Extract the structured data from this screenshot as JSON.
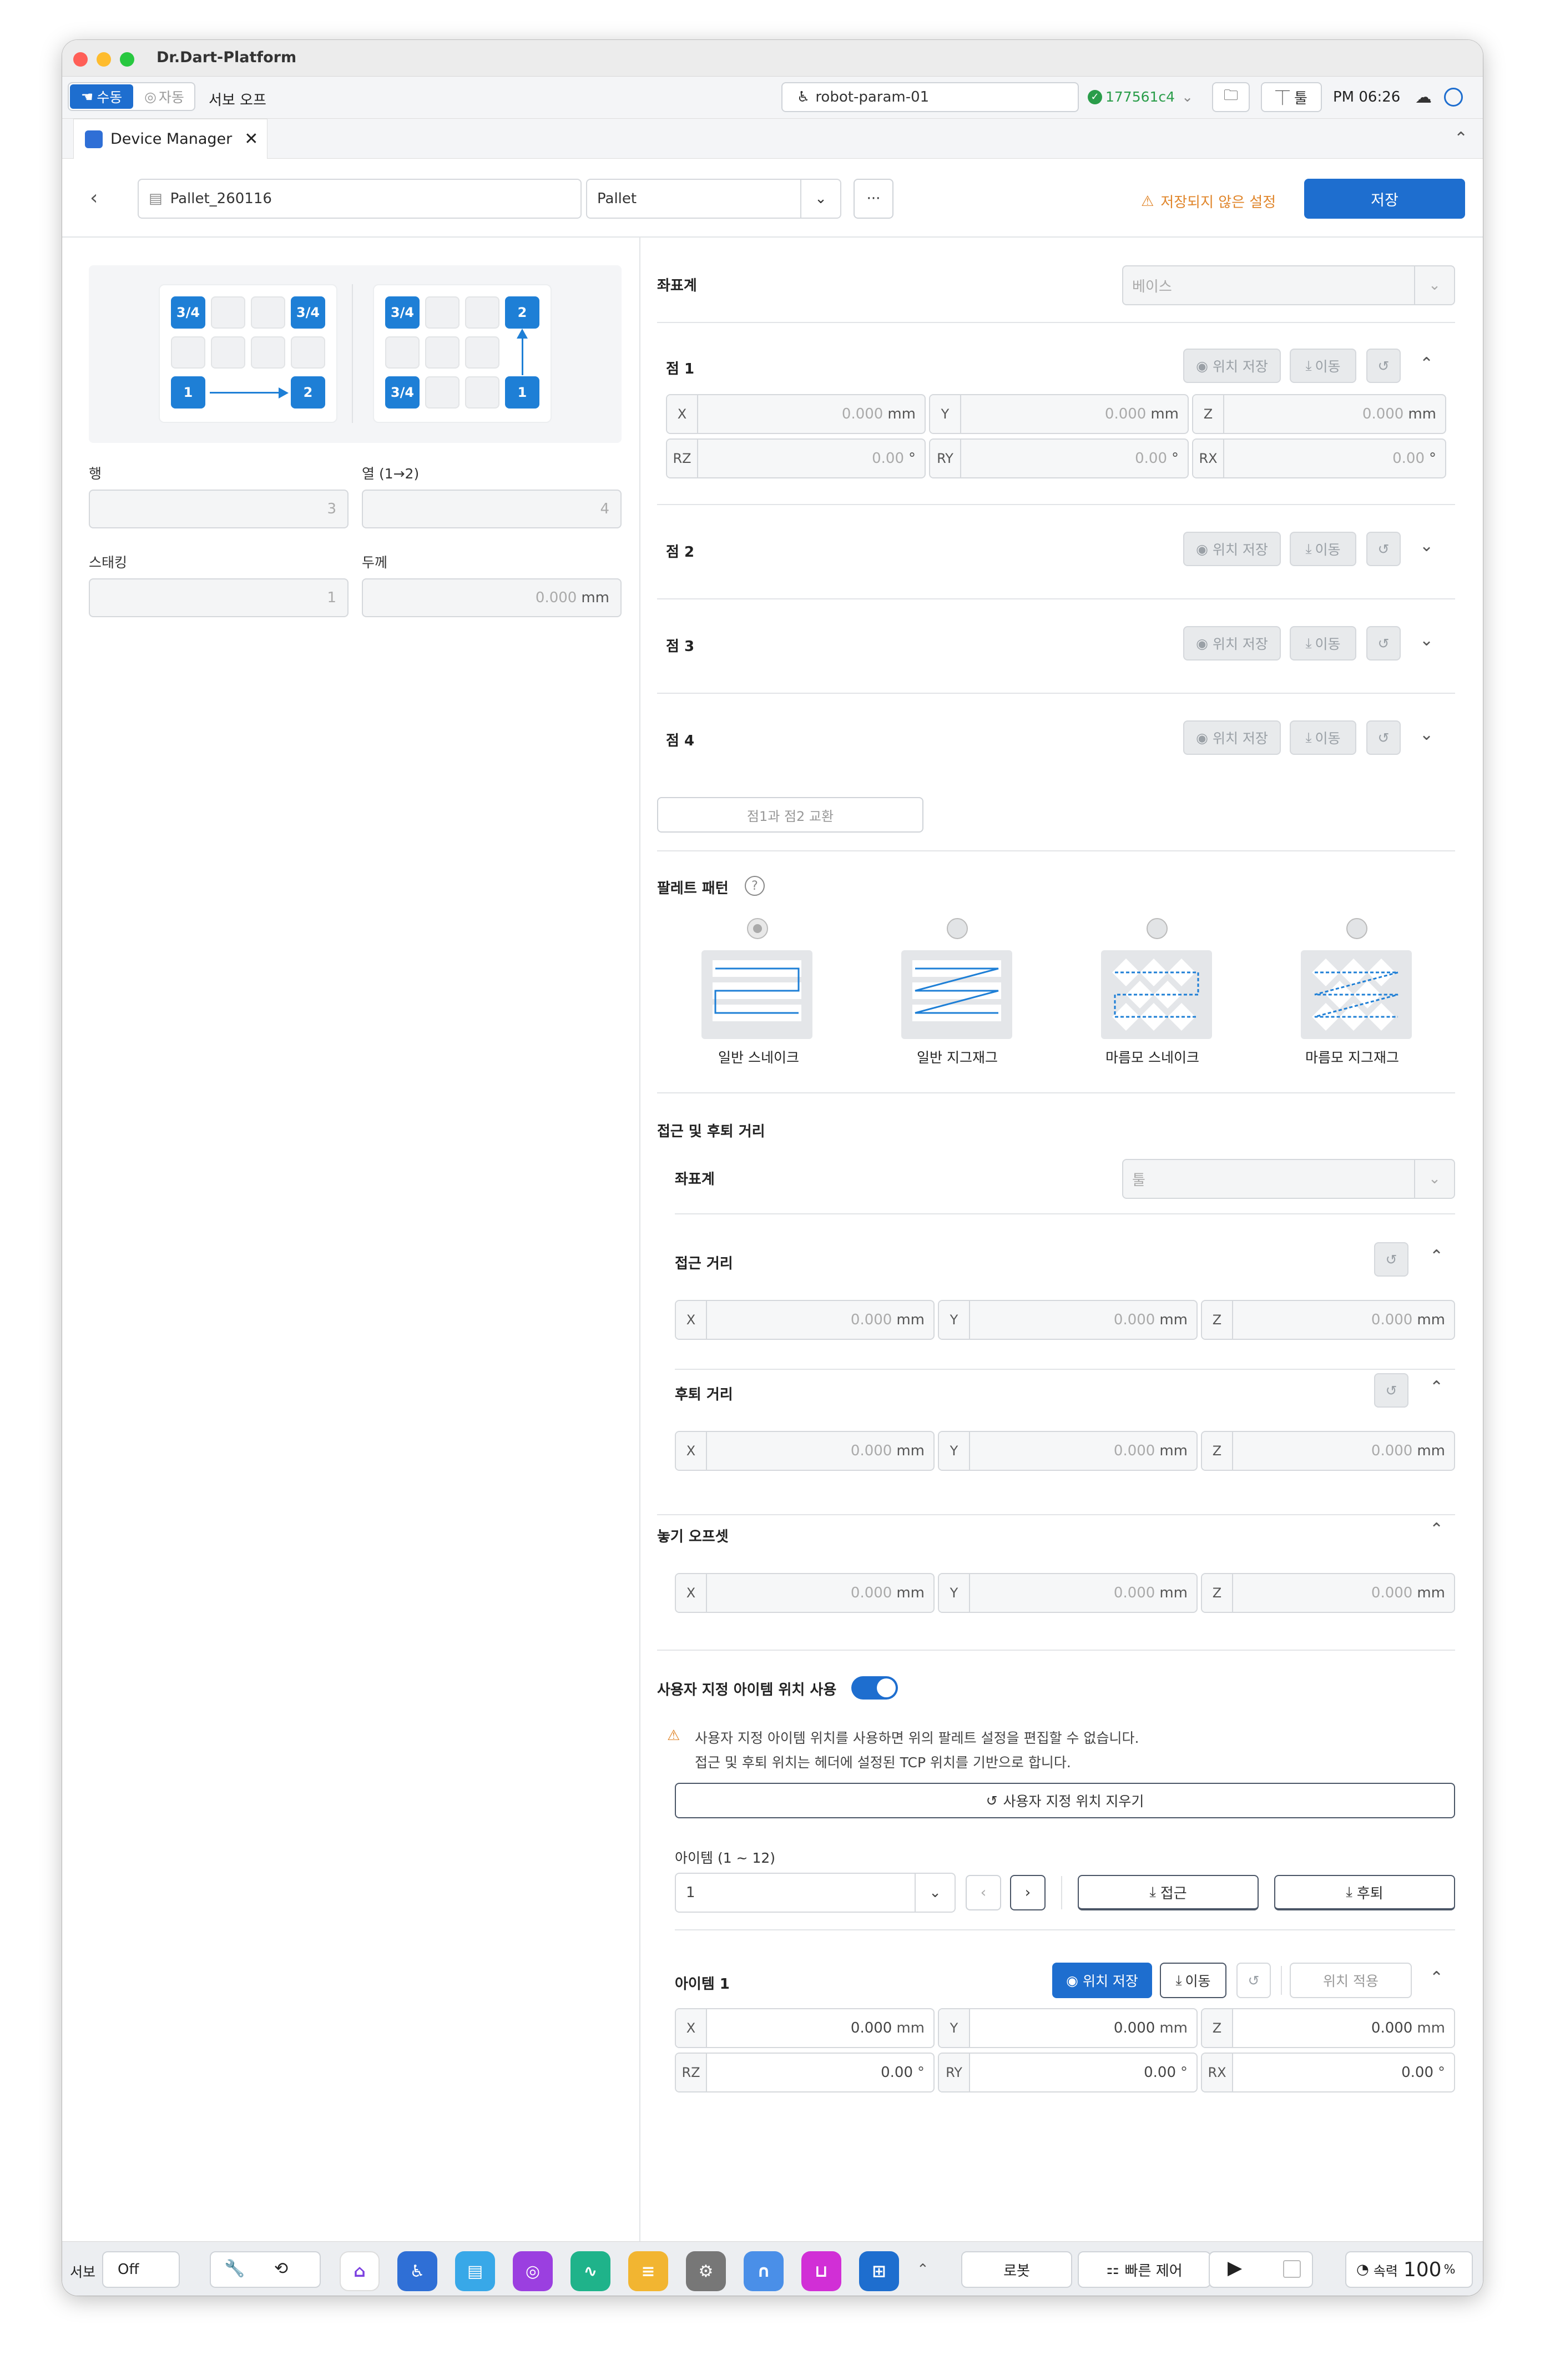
{
  "window": {
    "title": "Dr.Dart-Platform"
  },
  "topbar": {
    "manual": "수동",
    "auto": "자동",
    "servo_off": "서보 오프",
    "robot": "robot-param-01",
    "version": "177561c4",
    "tool": "툴",
    "time": "PM 06:26"
  },
  "tab": {
    "label": "Device Manager"
  },
  "header": {
    "file_name": "Pallet_260116",
    "type": "Pallet",
    "more": "···",
    "unsaved": "저장되지 않은 설정",
    "save": "저장"
  },
  "left": {
    "diagram1": {
      "tl": "3/4",
      "tr": "3/4",
      "bl": "1",
      "br": "2"
    },
    "diagram2": {
      "tl": "3/4",
      "tr": "2",
      "bl": "3/4",
      "br": "1"
    },
    "row_label": "행",
    "row_value": "3",
    "col_label": "열 (1→2)",
    "col_value": "4",
    "stack_label": "스태킹",
    "stack_value": "1",
    "thick_label": "두께",
    "thick_value": "0.000",
    "thick_unit": "mm"
  },
  "right": {
    "coord_label": "좌표계",
    "coord_value": "베이스",
    "save_pos": "위치 저장",
    "move": "이동",
    "points": [
      {
        "label": "점 1"
      },
      {
        "label": "점 2"
      },
      {
        "label": "점 3"
      },
      {
        "label": "점 4"
      }
    ],
    "p1": {
      "x": "0.000",
      "y": "0.000",
      "z": "0.000",
      "rz": "0.00",
      "ry": "0.00",
      "rx": "0.00"
    },
    "unit_mm": "mm",
    "unit_deg": "°",
    "swap": "점1과 점2 교환",
    "pattern_title": "팔레트 패턴",
    "patterns": [
      "일반 스네이크",
      "일반 지그재그",
      "마름모 스네이크",
      "마름모 지그재그"
    ],
    "approach_title": "접근 및 후퇴 거리",
    "approach_coord_label": "좌표계",
    "approach_coord_value": "툴",
    "approach_dist": "접근 거리",
    "retreat_dist": "후퇴 거리",
    "place_offset": "놓기 오프셋",
    "zero": "0.000",
    "custom_toggle": "사용자 지정 아이템 위치 사용",
    "warning1": "사용자 지정 아이템 위치를 사용하면 위의 팔레트 설정을 편집할 수 없습니다.",
    "warning2": "접근 및 후퇴 위치는 헤더에 설정된 TCP 위치를 기반으로 합니다.",
    "clear_custom": "사용자 지정 위치 지우기",
    "item_range": "아이템 (1 ~ 12)",
    "item_select": "1",
    "approach_btn": "접근",
    "retreat_btn": "후퇴",
    "item_title": "아이템 1",
    "apply_pos": "위치 적용",
    "item": {
      "x": "0.000",
      "y": "0.000",
      "z": "0.000",
      "rz": "0.00",
      "ry": "0.00",
      "rx": "0.00"
    }
  },
  "dock": {
    "servo": "서보",
    "servo_state": "Off",
    "robot": "로봇",
    "quick": "빠른 제어",
    "speed_label": "속력",
    "speed": "100",
    "speed_unit": "%"
  }
}
